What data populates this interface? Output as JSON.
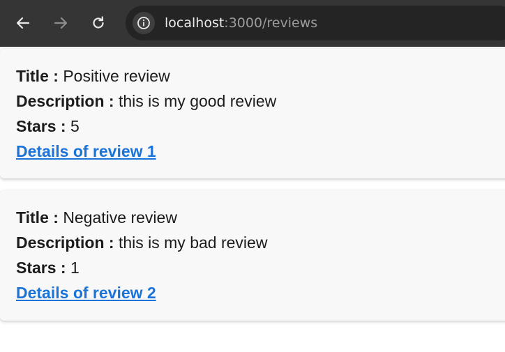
{
  "browser": {
    "url_host": "localhost",
    "url_path": ":3000/reviews",
    "icons": [
      "back-arrow-icon",
      "forward-arrow-icon",
      "reload-icon",
      "info-icon"
    ]
  },
  "labels": {
    "title": "Title :",
    "description": "Description :",
    "stars": "Stars :"
  },
  "reviews": [
    {
      "title": "Positive review",
      "description": "this is my good review",
      "stars": "5",
      "link": "Details of review 1"
    },
    {
      "title": "Negative review",
      "description": "this is my bad review",
      "stars": "1",
      "link": "Details of review 2"
    }
  ],
  "colors": {
    "browser_bar": "#353535",
    "omnibox": "#242424",
    "card_bg": "#f8f8f8",
    "link": "#1a73d9"
  }
}
